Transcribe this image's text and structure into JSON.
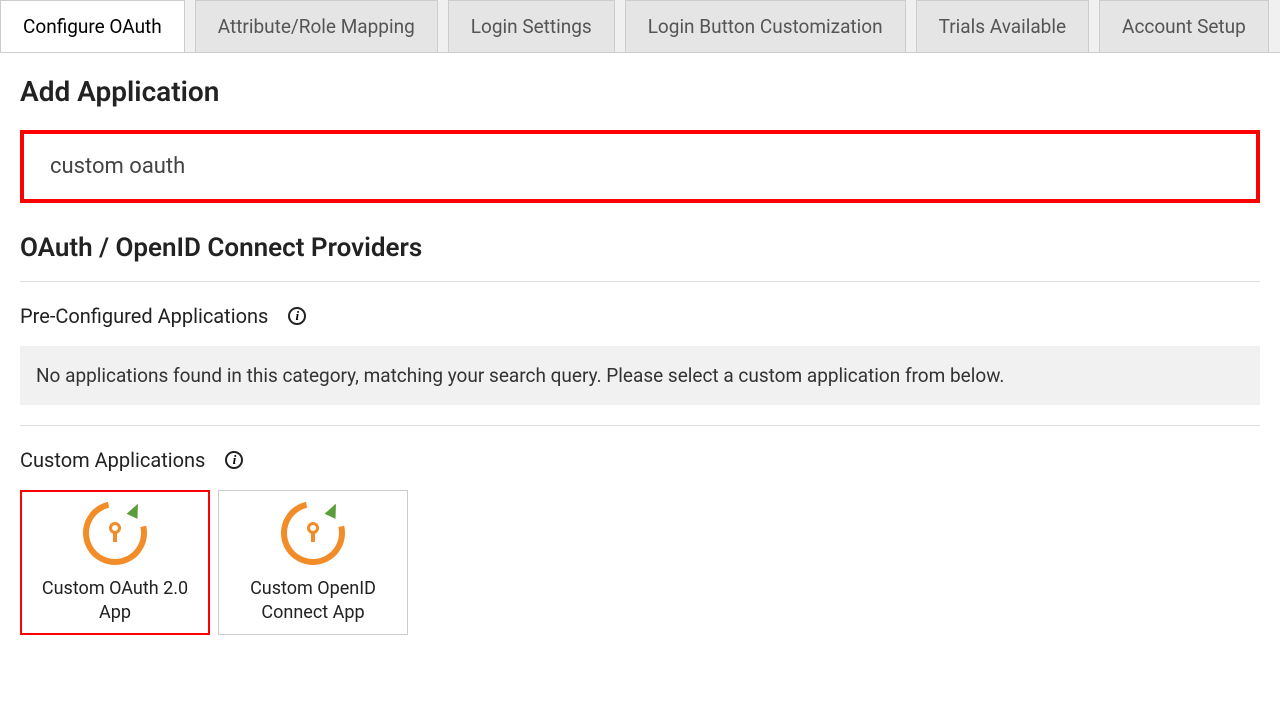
{
  "tabs": [
    {
      "label": "Configure OAuth",
      "active": true
    },
    {
      "label": "Attribute/Role Mapping",
      "active": false
    },
    {
      "label": "Login Settings",
      "active": false
    },
    {
      "label": "Login Button Customization",
      "active": false
    },
    {
      "label": "Trials Available",
      "active": false
    },
    {
      "label": "Account Setup",
      "active": false
    }
  ],
  "page": {
    "title": "Add Application",
    "search_value": "custom oauth",
    "providers_heading": "OAuth / OpenID Connect Providers"
  },
  "preconfigured": {
    "heading": "Pre-Configured Applications",
    "empty_message": "No applications found in this category, matching your search query. Please select a custom application from below."
  },
  "custom": {
    "heading": "Custom Applications",
    "apps": [
      {
        "label": "Custom OAuth 2.0 App",
        "selected": true
      },
      {
        "label": "Custom OpenID Connect App",
        "selected": false
      }
    ]
  }
}
